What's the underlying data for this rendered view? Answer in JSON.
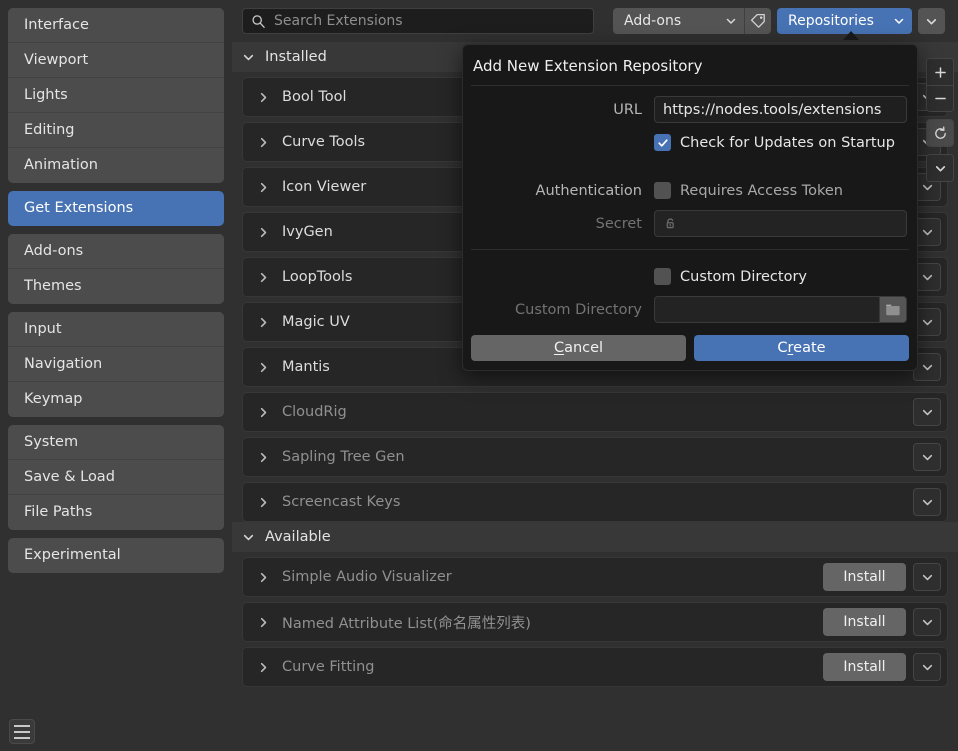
{
  "sidebar": {
    "groups": [
      {
        "items": [
          {
            "label": "Interface",
            "selected": false
          },
          {
            "label": "Viewport",
            "selected": false
          },
          {
            "label": "Lights",
            "selected": false
          },
          {
            "label": "Editing",
            "selected": false
          },
          {
            "label": "Animation",
            "selected": false
          }
        ]
      },
      {
        "items": [
          {
            "label": "Get Extensions",
            "selected": true
          }
        ]
      },
      {
        "items": [
          {
            "label": "Add-ons",
            "selected": false
          },
          {
            "label": "Themes",
            "selected": false
          }
        ]
      },
      {
        "items": [
          {
            "label": "Input",
            "selected": false
          },
          {
            "label": "Navigation",
            "selected": false
          },
          {
            "label": "Keymap",
            "selected": false
          }
        ]
      },
      {
        "items": [
          {
            "label": "System",
            "selected": false
          },
          {
            "label": "Save & Load",
            "selected": false
          },
          {
            "label": "File Paths",
            "selected": false
          }
        ]
      },
      {
        "items": [
          {
            "label": "Experimental",
            "selected": false
          }
        ]
      }
    ],
    "menu_icon": "hamburger-menu-icon"
  },
  "toolbar": {
    "search": {
      "icon": "search-icon",
      "value": "",
      "placeholder": "Search Extensions"
    },
    "filter_dropdown": {
      "label": "Add-ons",
      "icon": "chevron-down-icon"
    },
    "tag_button": {
      "icon": "tag-icon"
    },
    "repositories_dropdown": {
      "label": "Repositories",
      "icon": "chevron-down-icon",
      "accent": "#4772b3"
    },
    "overflow_button": {
      "icon": "chevron-down-icon"
    }
  },
  "side_tools": [
    {
      "name": "add-repository-button",
      "icon": "plus-icon"
    },
    {
      "name": "remove-repository-button",
      "icon": "minus-icon"
    },
    {
      "name": "refresh-button",
      "icon": "refresh-icon"
    },
    {
      "name": "repository-options-button",
      "icon": "chevron-down-icon"
    }
  ],
  "sections": [
    {
      "title": "Installed",
      "expanded": true,
      "icon": "chevron-down-icon",
      "rows": [
        {
          "name": "Bool Tool",
          "dim": false,
          "install": null
        },
        {
          "name": "Curve Tools",
          "dim": false,
          "install": null
        },
        {
          "name": "Icon Viewer",
          "dim": false,
          "install": null
        },
        {
          "name": "IvyGen",
          "dim": false,
          "install": null
        },
        {
          "name": "LoopTools",
          "dim": false,
          "install": null
        },
        {
          "name": "Magic UV",
          "dim": false,
          "install": null
        },
        {
          "name": "Mantis",
          "dim": false,
          "install": null
        },
        {
          "name": "CloudRig",
          "dim": true,
          "install": null
        },
        {
          "name": "Sapling Tree Gen",
          "dim": true,
          "install": null
        },
        {
          "name": "Screencast Keys",
          "dim": true,
          "install": null
        }
      ]
    },
    {
      "title": "Available",
      "expanded": true,
      "icon": "chevron-down-icon",
      "rows": [
        {
          "name": "Simple Audio Visualizer",
          "dim": true,
          "install": "Install"
        },
        {
          "name": "Named Attribute List(命名属性列表)",
          "dim": true,
          "install": "Install"
        },
        {
          "name": "Curve Fitting",
          "dim": true,
          "install": "Install"
        }
      ]
    }
  ],
  "dialog": {
    "title": "Add New Extension Repository",
    "url_label": "URL",
    "url_value": "https://nodes.tools/extensions",
    "check_updates": {
      "label": "Check for Updates on Startup",
      "checked": true
    },
    "auth_label": "Authentication",
    "requires_token": {
      "label": "Requires Access Token",
      "checked": false
    },
    "secret_label": "Secret",
    "secret_value": "",
    "secret_icon": "lock-icon",
    "custom_directory_toggle": {
      "label": "Custom Directory",
      "checked": false
    },
    "custom_directory_label": "Custom Directory",
    "custom_directory_value": "",
    "folder_icon": "folder-icon",
    "cancel_button": {
      "pre": "",
      "accel": "C",
      "post": "ancel"
    },
    "create_button": {
      "pre": "C",
      "accel": "r",
      "post": "eate"
    }
  }
}
